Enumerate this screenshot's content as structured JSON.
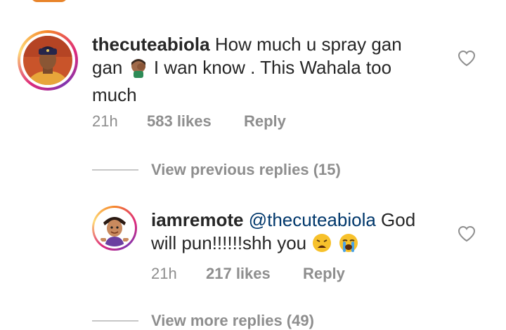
{
  "comments": [
    {
      "username": "thecuteabiola",
      "text_line1": "How much u spray gan",
      "text_line2_a": "gan",
      "text_line2_b": "I wan know . This Wahala too",
      "text_line3": "much",
      "time": "21h",
      "likes": "583 likes",
      "reply_label": "Reply"
    },
    {
      "username": "iamremote",
      "mention": "@thecuteabiola",
      "text_line1_tail": "God",
      "text_line2": "will pun!!!!!!shh you",
      "time": "21h",
      "likes": "217 likes",
      "reply_label": "Reply"
    }
  ],
  "links": {
    "view_previous": "View previous replies (15)",
    "view_more": "View more replies (49)"
  },
  "icons": {
    "like": "heart-outline-icon",
    "facepalm": "facepalm-emoji",
    "weary": "weary-face-emoji",
    "crying": "loudly-crying-emoji"
  },
  "colors": {
    "text": "#262626",
    "secondary": "#8e8e8e",
    "mention": "#00376b",
    "ring_orange": "#f58529",
    "ring_pink": "#dd2a7b"
  }
}
